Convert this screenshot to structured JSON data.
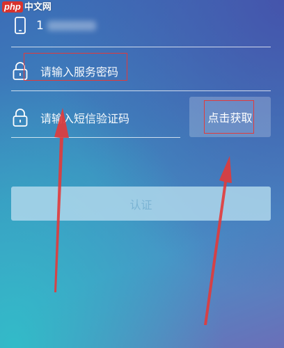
{
  "watermark": {
    "logo": "php",
    "text": "中文网"
  },
  "phone_field": {
    "visible_value": "1",
    "icon": "phone-icon"
  },
  "password_field": {
    "placeholder": "请输入服务密码",
    "icon": "lock-icon"
  },
  "sms_code_field": {
    "placeholder": "请输入短信验证码",
    "icon": "lock-icon"
  },
  "get_code_button": {
    "label": "点击获取"
  },
  "submit_button": {
    "label": "认证"
  },
  "colors": {
    "annotation": "#e23a3a",
    "submit_text": "#7ab3d3",
    "watermark_logo": "#d8322d"
  }
}
